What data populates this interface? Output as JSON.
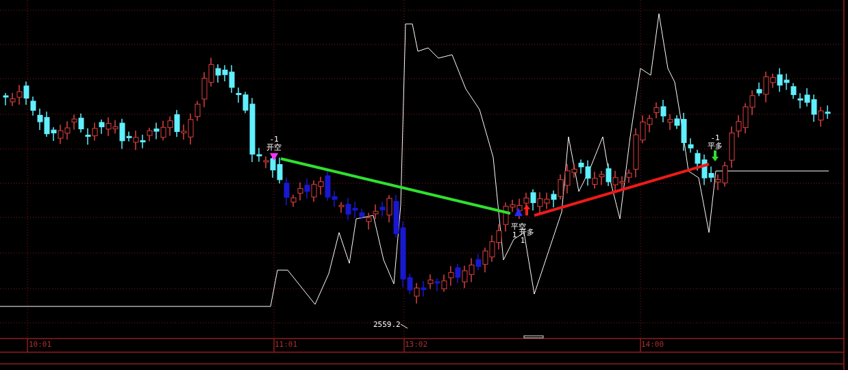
{
  "signals": [
    {
      "kind": "open_short",
      "count": "-1",
      "label": "开空"
    },
    {
      "kind": "close_short",
      "count": "1",
      "label": "平空"
    },
    {
      "kind": "open_long",
      "count": "1",
      "label": "开多"
    },
    {
      "kind": "close_long",
      "count": "-1",
      "label": "平多"
    }
  ],
  "price_label": "2559.2",
  "time_axis": {
    "labels": [
      "10:01",
      "11:01",
      "13:02",
      "14:00"
    ]
  }
}
